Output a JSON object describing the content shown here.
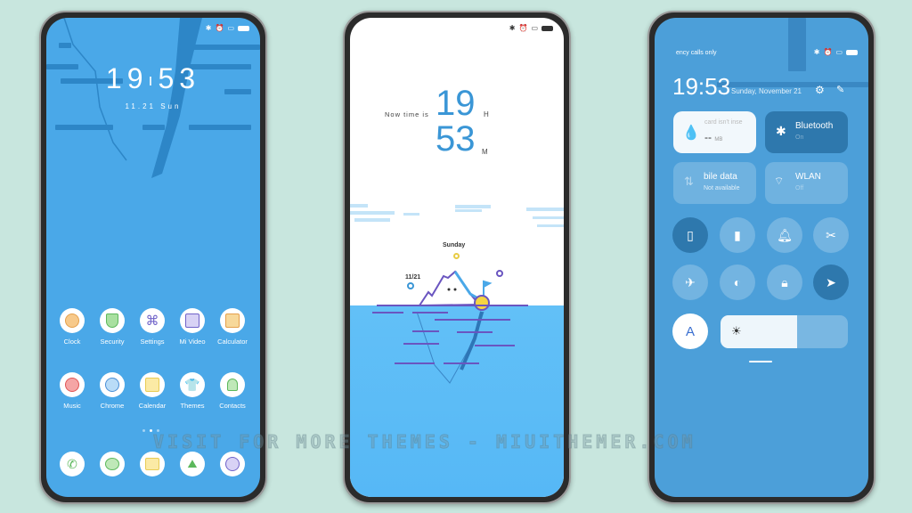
{
  "colors": {
    "background": "#c8e6de",
    "home_bg": "#4aa8e8",
    "sea": "#5bbcf5",
    "control_bg": "#4c9fd9",
    "active_toggle": "#2e78ad"
  },
  "home": {
    "clock_hours": "19",
    "clock_minutes": "53",
    "date": "11.21  Sun",
    "apps": [
      {
        "label": "Clock",
        "icon": "clock-icon"
      },
      {
        "label": "Security",
        "icon": "shield-icon"
      },
      {
        "label": "Settings",
        "icon": "settings-icon"
      },
      {
        "label": "Mi Video",
        "icon": "video-icon"
      },
      {
        "label": "Calculator",
        "icon": "calculator-icon"
      },
      {
        "label": "Music",
        "icon": "music-icon"
      },
      {
        "label": "Chrome",
        "icon": "planet-icon"
      },
      {
        "label": "Calendar",
        "icon": "calendar-icon"
      },
      {
        "label": "Themes",
        "icon": "shirt-icon"
      },
      {
        "label": "Contacts",
        "icon": "person-icon"
      }
    ],
    "dock": [
      "phone-icon",
      "message-icon",
      "notes-icon",
      "gallery-icon",
      "camera-icon"
    ],
    "page_index": 2,
    "page_count": 3
  },
  "lock": {
    "prefix": "Now time is",
    "hours": "19",
    "hours_unit": "H",
    "minutes": "53",
    "minutes_unit": "M",
    "day": "Sunday",
    "date": "11/21"
  },
  "control": {
    "carrier": "ency calls only",
    "time": "19:53",
    "date": "Sunday, November 21",
    "tiles": [
      {
        "title": "card isn't inse",
        "value": "--",
        "unit": "MB",
        "icon": "drop-icon"
      },
      {
        "title": "Bluetooth",
        "value": "On",
        "icon": "bluetooth-icon"
      },
      {
        "title": "bile data",
        "value": "Not available",
        "icon": "data-icon"
      },
      {
        "title": "WLAN",
        "value": "Off",
        "icon": "wifi-icon"
      }
    ],
    "toggles": [
      {
        "name": "vibrate",
        "active": true
      },
      {
        "name": "flashlight",
        "active": false
      },
      {
        "name": "bell",
        "active": false
      },
      {
        "name": "screenshot",
        "active": false
      },
      {
        "name": "airplane",
        "active": false
      },
      {
        "name": "reading-mode",
        "active": false
      },
      {
        "name": "lock",
        "active": false
      },
      {
        "name": "location",
        "active": true
      }
    ],
    "auto_brightness_label": "A",
    "brightness_percent": 60
  },
  "watermark": "VISIT FOR MORE THEMES - MIUITHEMER.COM"
}
